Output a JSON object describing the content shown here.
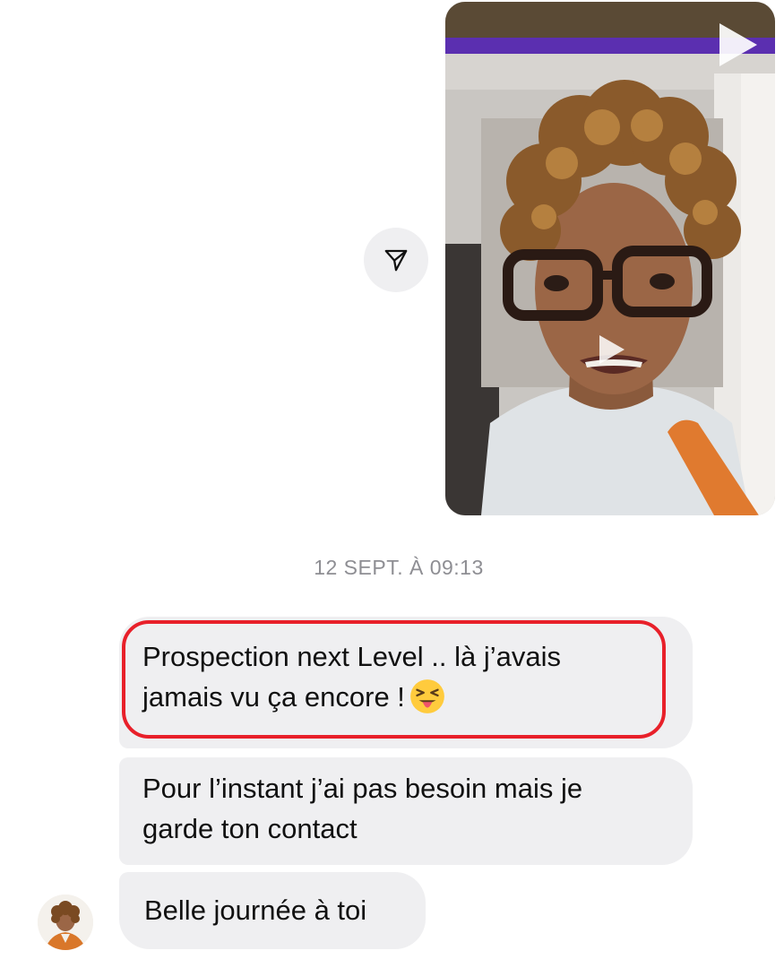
{
  "conversation": {
    "video": {
      "icon_corner": "play-icon",
      "icon_center": "play-icon"
    },
    "share_icon": "send-icon",
    "timestamp": "12 SEPT. À 09:13",
    "messages": [
      {
        "lines": [
          "Prospection next Level .. là j’avais",
          "jamais vu ça encore !"
        ],
        "emoji": "squinting-face-with-tongue"
      },
      {
        "lines": [
          "Pour l’instant j’ai pas besoin mais je",
          "garde ton contact"
        ]
      },
      {
        "lines": [
          "Belle journée à toi"
        ]
      }
    ],
    "highlight_color": "#e8202a",
    "bubble_color": "#efeff1"
  }
}
